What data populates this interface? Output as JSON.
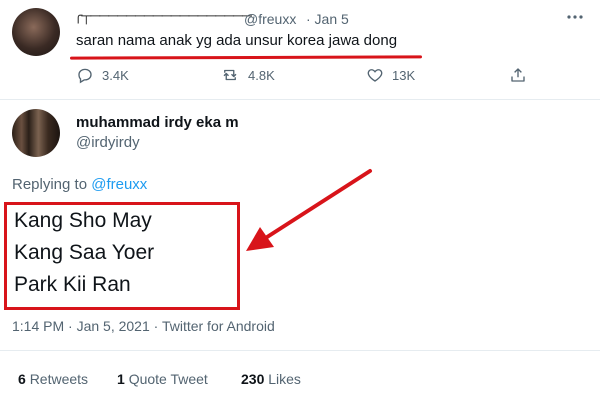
{
  "parent_tweet": {
    "display_name": "╭┬──────────────────",
    "handle": "@freuxx",
    "date": "· Jan 5",
    "text": "saran nama anak yg ada unsur korea jawa dong",
    "replies": "3.4K",
    "retweets": "4.8K",
    "likes": "13K"
  },
  "reply_tweet": {
    "display_name": "muhammad irdy eka m",
    "handle": "@irdyirdy",
    "replying_to_label": "Replying to",
    "replying_to_handle": "@freuxx",
    "lines": [
      "Kang Sho May",
      "Kang Saa Yoer",
      "Park Kii Ran"
    ],
    "meta": "1:14 PM · Jan 5, 2021 · Twitter for Android"
  },
  "stats": {
    "retweets_count": "6",
    "retweets_label": "Retweets",
    "quotes_count": "1",
    "quotes_label": "Quote Tweet",
    "likes_count": "230",
    "likes_label": "Likes"
  },
  "colors": {
    "accent": "#1d9bf0",
    "annotation_red": "#d8141a",
    "text": "#0f1419",
    "muted": "#536471"
  }
}
